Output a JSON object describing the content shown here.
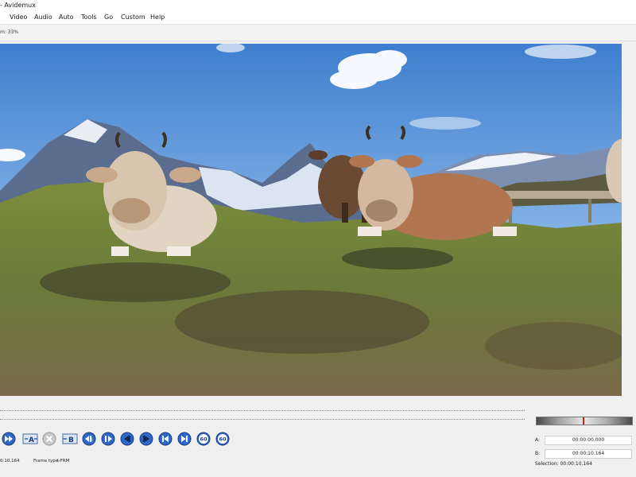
{
  "window": {
    "title": "- Avidemux"
  },
  "menu": [
    "Video",
    "Audio",
    "Auto",
    "Tools",
    "Go",
    "Custom",
    "Help"
  ],
  "toolbar": {
    "zoom_text": "m: 33%"
  },
  "navigation_buttons": [
    {
      "icon": "fast-forward-icon"
    },
    {
      "icon": "set-marker-a-icon",
      "label": "A"
    },
    {
      "icon": "delete-icon"
    },
    {
      "icon": "set-marker-b-icon",
      "label": "B"
    },
    {
      "icon": "previous-intra-frame-icon"
    },
    {
      "icon": "next-intra-frame-icon"
    },
    {
      "icon": "previous-frame-icon"
    },
    {
      "icon": "next-frame-icon"
    },
    {
      "icon": "go-to-first-frame-icon"
    },
    {
      "icon": "go-to-last-frame-icon"
    },
    {
      "icon": "back-60s-icon",
      "label": "60"
    },
    {
      "icon": "forward-60s-icon",
      "label": "60"
    }
  ],
  "status": {
    "time": "0:10.164",
    "frame_type_label": "Frame type:",
    "frame_type": "I-FRM"
  },
  "selection": {
    "a_label": "A:",
    "a_value": "00:00:00.000",
    "b_label": "B:",
    "b_value": "00:00:10.164",
    "selection_text": "Selection: 00:00:10.164"
  },
  "colors": {
    "sky": "#6fa3de",
    "grass": "#6b7a3a",
    "button_blue": "#2d67c9",
    "marker": "#d21b1b"
  }
}
